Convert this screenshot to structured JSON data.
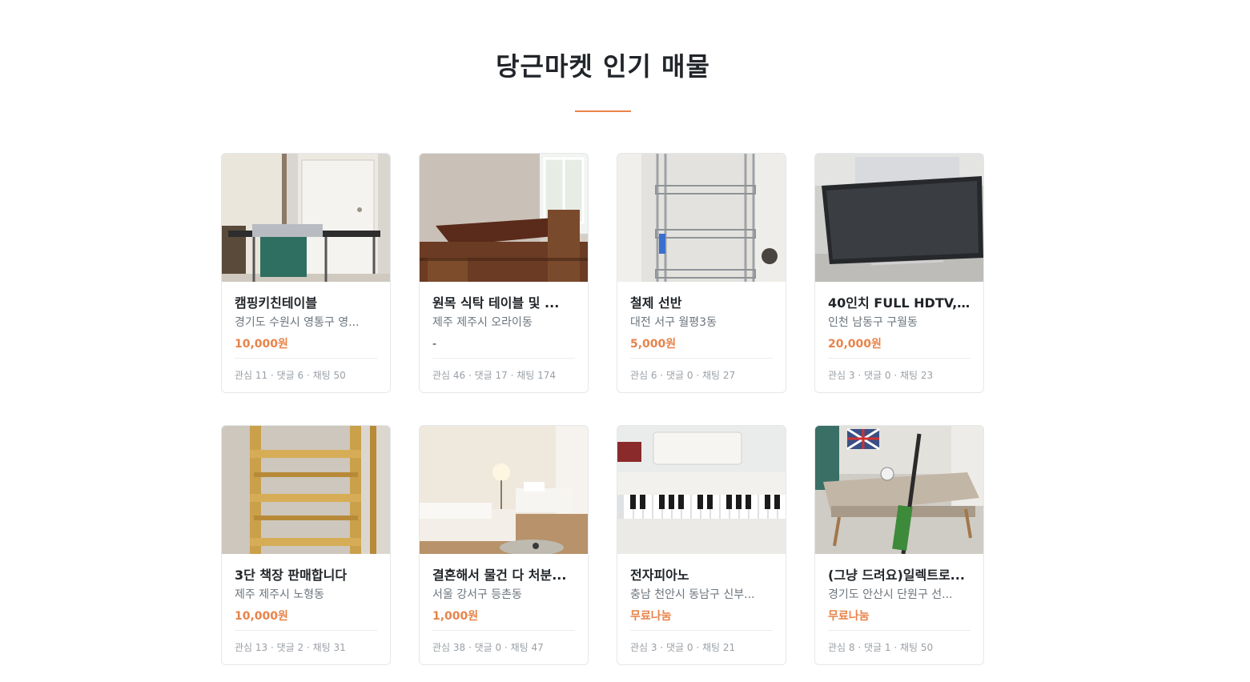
{
  "section": {
    "title": "당근마켓 인기 매물",
    "accent_color": "#e8834a"
  },
  "items": [
    {
      "title": "캠핑키친테이블",
      "region": "경기도 수원시 영통구 영...",
      "price": "10,000원",
      "counts": "관심 11 · 댓글 6 · 채팅 50",
      "image": "camping-kitchen-table-photo"
    },
    {
      "title": "원목 식탁 테이블 및 ...",
      "region": "제주 제주시 오라이동",
      "price": "-",
      "counts": "관심 46 · 댓글 17 · 채팅 174",
      "image": "wooden-dining-table-photo"
    },
    {
      "title": "철제 선반",
      "region": "대전 서구 월평3동",
      "price": "5,000원",
      "counts": "관심 6 · 댓글 0 · 채팅 27",
      "image": "steel-shelf-photo"
    },
    {
      "title": "40인치 FULL HDTV, N...",
      "region": "인천 남동구 구월동",
      "price": "20,000원",
      "counts": "관심 3 · 댓글 0 · 채팅 23",
      "image": "tv-photo"
    },
    {
      "title": "3단 책장 판매합니다",
      "region": "제주 제주시 노형동",
      "price": "10,000원",
      "counts": "관심 13 · 댓글 2 · 채팅 31",
      "image": "bookshelf-photo"
    },
    {
      "title": "결혼해서 물건 다 처분...",
      "region": "서울 강서구 등촌동",
      "price": "1,000원",
      "counts": "관심 38 · 댓글 0 · 채팅 47",
      "image": "living-room-sofa-photo"
    },
    {
      "title": "전자피아노",
      "region": "충남 천안시 동남구 신부...",
      "price": "무료나눔",
      "counts": "관심 3 · 댓글 0 · 채팅 21",
      "image": "digital-piano-photo"
    },
    {
      "title": "(그냥 드려요)일렉트로...",
      "region": "경기도 안산시 단원구 선...",
      "price": "무료나눔",
      "counts": "관심 8 · 댓글 1 · 채팅 50",
      "image": "vacuum-table-photo"
    }
  ]
}
